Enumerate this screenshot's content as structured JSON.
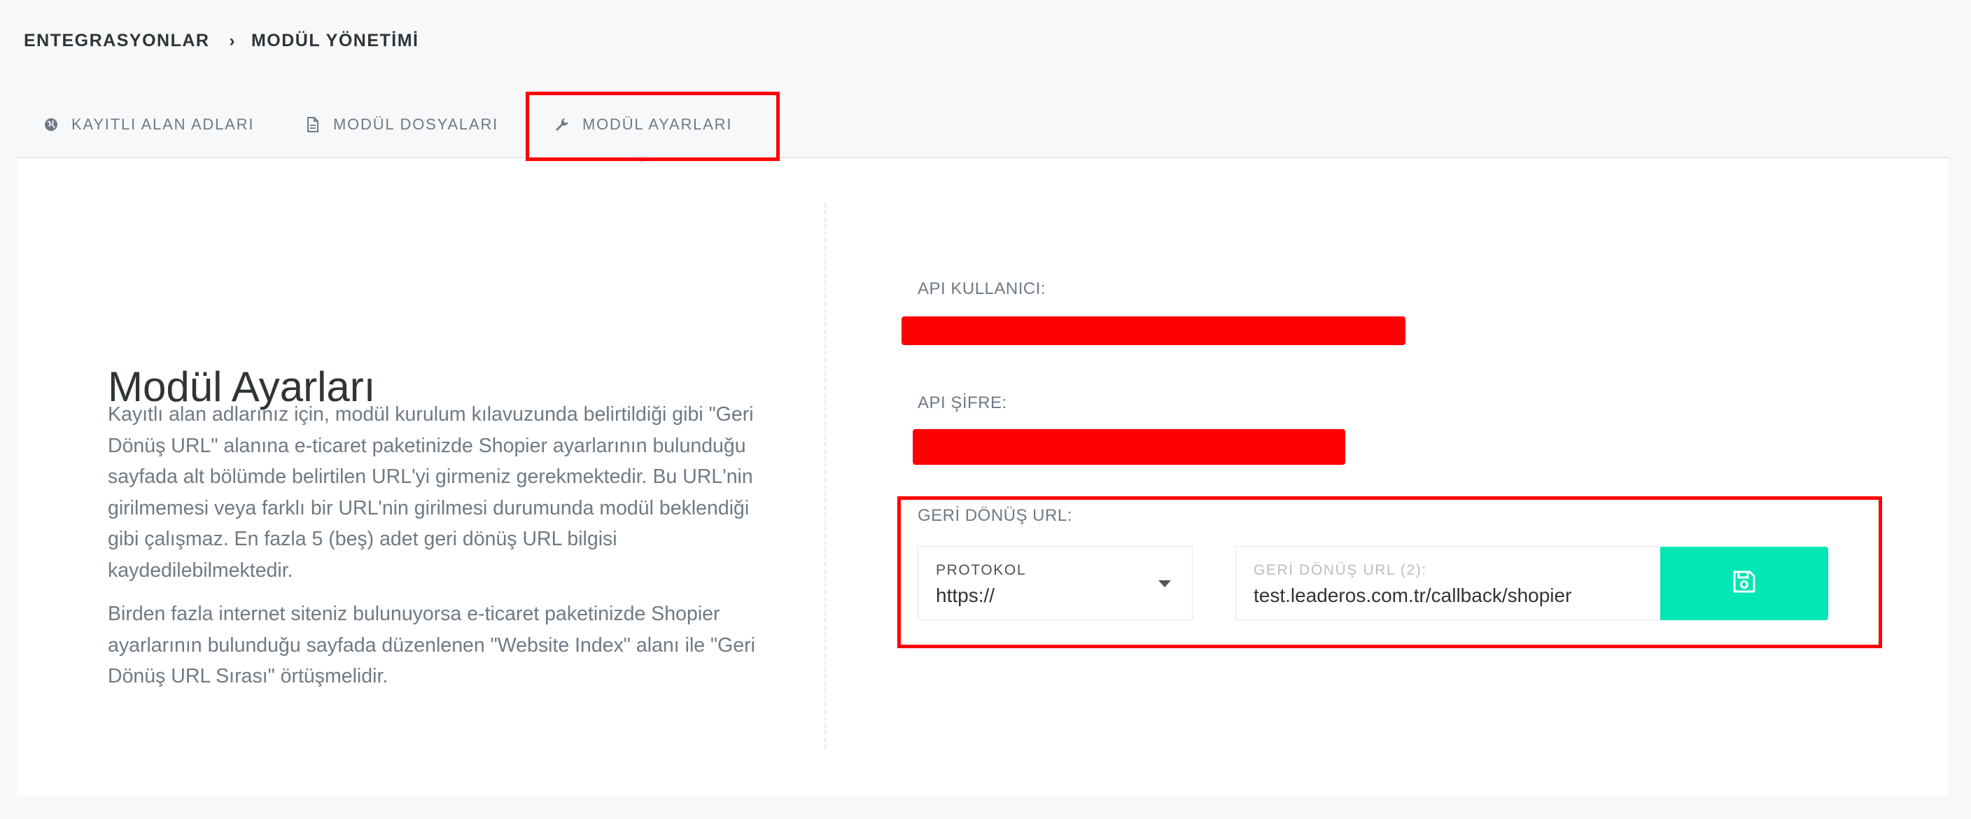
{
  "breadcrumb": {
    "items": [
      "ENTEGRASYONLAR",
      "MODÜL YÖNETİMİ"
    ],
    "separator": "›"
  },
  "tabs": [
    {
      "label": "KAYITLI ALAN ADLARI",
      "icon": "globe-icon",
      "active": false
    },
    {
      "label": "MODÜL DOSYALARI",
      "icon": "file-icon",
      "active": false
    },
    {
      "label": "MODÜL AYARLARI",
      "icon": "wrench-icon",
      "active": true
    }
  ],
  "main": {
    "title": "Modül Ayarları",
    "paragraphs": [
      "Kayıtlı alan adlarınız için, modül kurulum kılavuzunda belirtildiği gibi \"Geri Dönüş URL\" alanına e-ticaret paketinizde Shopier ayarlarının bulunduğu sayfada alt bölümde belirtilen URL'yi girmeniz gerekmektedir. Bu URL'nin girilmemesi veya farklı bir URL'nin girilmesi durumunda modül beklendiği gibi çalışmaz. En fazla 5 (beş) adet geri dönüş URL bilgisi kaydedilebilmektedir.",
      "Birden fazla internet siteniz bulunuyorsa e-ticaret paketinizde Shopier ayarlarının bulunduğu sayfada düzenlenen \"Website Index\" alanı ile \"Geri Dönüş URL Sırası\" örtüşmelidir."
    ]
  },
  "form": {
    "api_user_label": "API KULLANICI:",
    "api_password_label": "API ŞİFRE:",
    "callback_label": "GERİ DÖNÜŞ URL:",
    "protocol": {
      "caption": "PROTOKOL",
      "value": "https://"
    },
    "callback_url": {
      "caption": "GERİ DÖNÜŞ URL (2):",
      "value": "test.leaderos.com.tr/callback/shopier"
    },
    "save_icon": "save-icon"
  },
  "colors": {
    "accent": "#00e6b4",
    "highlight": "#ff0000",
    "background": "#f7f8fa"
  }
}
